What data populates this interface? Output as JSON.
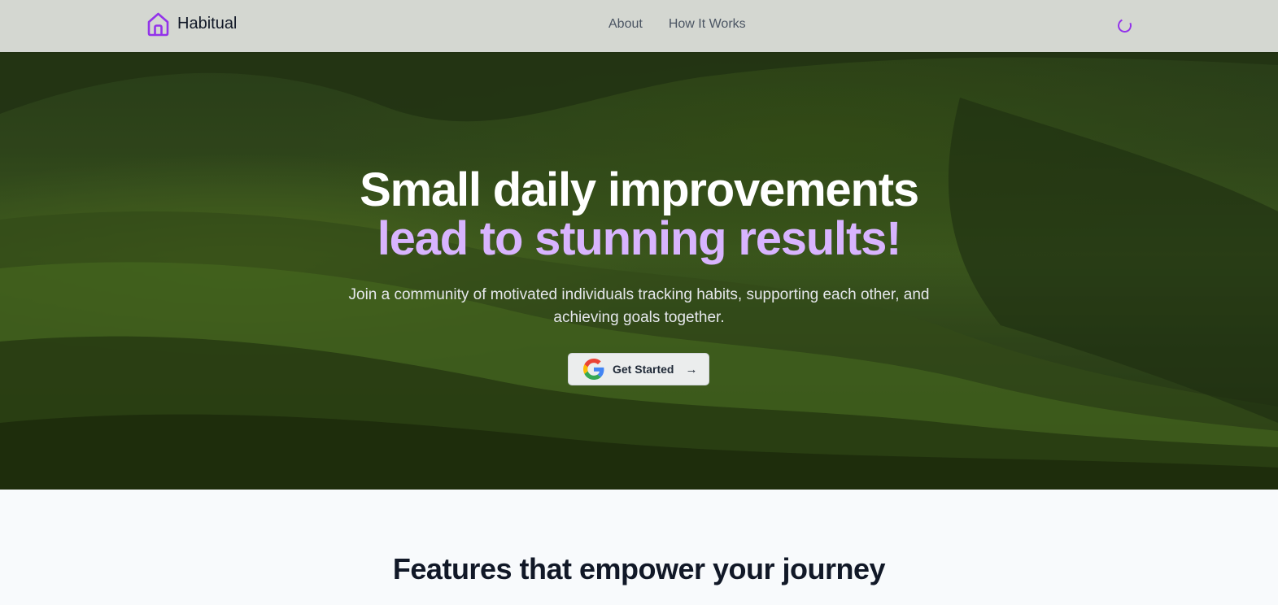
{
  "brand": {
    "name": "Habitual",
    "icon": "home-icon"
  },
  "nav": {
    "links": [
      {
        "label": "About"
      },
      {
        "label": "How It Works"
      }
    ]
  },
  "status": {
    "icon": "loading-spinner"
  },
  "hero": {
    "headline_line1": "Small daily improvements",
    "headline_line2": "lead to stunning results!",
    "subtitle": "Join a community of motivated individuals tracking habits, supporting each other, and achieving goals together.",
    "cta": {
      "label": "Get Started",
      "icon": "google-icon",
      "trailing_icon": "arrow-right-icon"
    }
  },
  "features": {
    "title": "Features that empower your journey"
  },
  "colors": {
    "accent": "#9333ea",
    "accent_light": "#d8b4fe",
    "text_dark": "#111827",
    "page_bg": "#f8fafc"
  }
}
